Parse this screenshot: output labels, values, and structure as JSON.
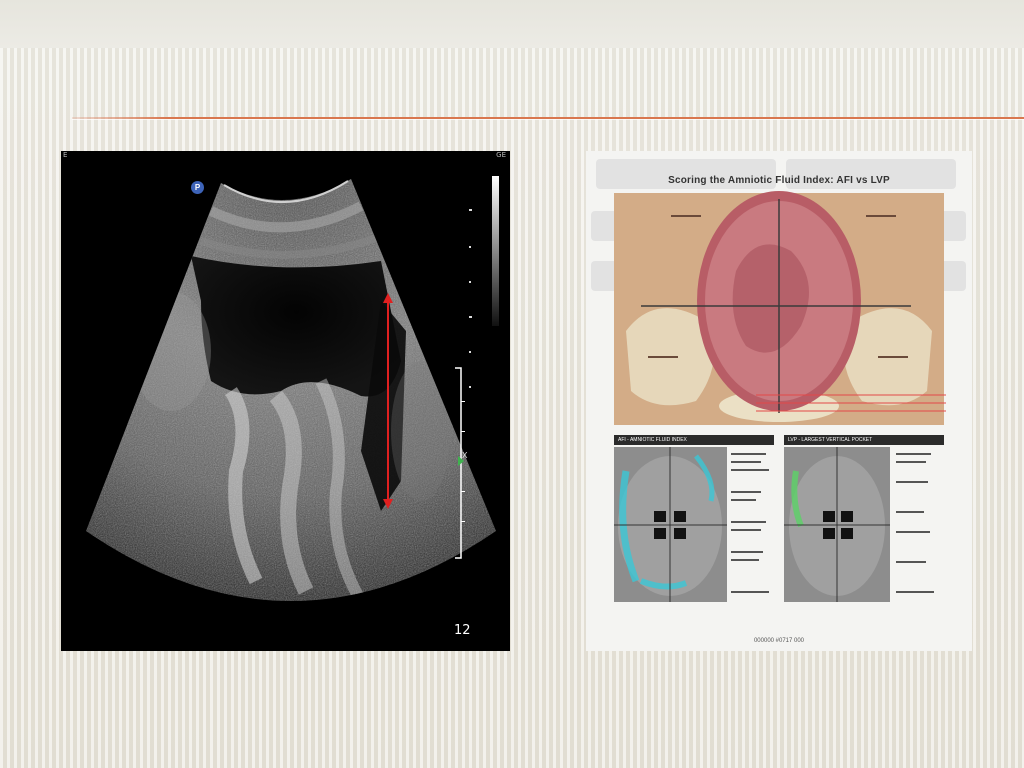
{
  "slide": {
    "background_color": "#ebe8df",
    "accent_rule_color": "#d9774f"
  },
  "ultrasound": {
    "corner_left": "E",
    "corner_right": "GE",
    "probe_marker": "P",
    "marker_label": "X",
    "depth": "12",
    "measure_line_color": "#e02020"
  },
  "afi_diagram": {
    "title": "Scoring the Amniotic Fluid Index: AFI vs LVP",
    "left_header": "AFI - AMNIOTIC FLUID INDEX",
    "right_header": "LVP - LARGEST VERTICAL POCKET",
    "footer": "000000 #0717 000"
  }
}
